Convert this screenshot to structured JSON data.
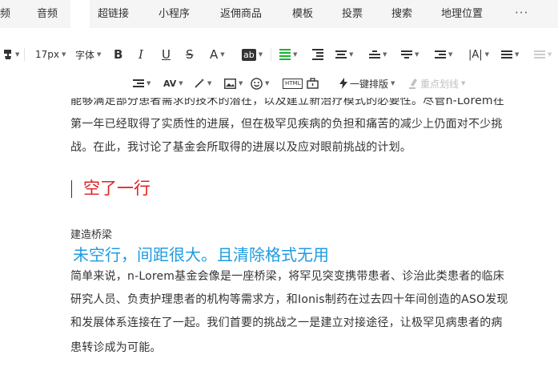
{
  "insert_bar": {
    "items": [
      {
        "label": "频"
      },
      {
        "label": "音频"
      },
      {
        "label": "超链接"
      },
      {
        "label": "小程序"
      },
      {
        "label": "返佣商品"
      },
      {
        "label": "模板"
      },
      {
        "label": "投票"
      },
      {
        "label": "搜索"
      },
      {
        "label": "地理位置"
      }
    ],
    "more": "···"
  },
  "toolbar": {
    "font_size": "17px",
    "font_family": "字体",
    "bold": "B",
    "italic": "I",
    "underline": "U",
    "strike": "S",
    "font_color": "A",
    "background_color": "ab",
    "one_click_layout": "一键排版",
    "highlight": "重点划线",
    "colors": {
      "align_active": "#17b530",
      "disabled": "#c0c0c0"
    }
  },
  "content": {
    "para1_line0": "能够满足部分患者需求的技术的潜在，以及建立新治疗模式的必要性。尽管n-Lorem在",
    "para1_line1": "第一年已经取得了实质性的进展，但在极罕见疾病的负担和痛苦的减少上仍面对不少挑",
    "para1_line2": "战。在此，我讨论了基金会所取得的进展以及应对眼前挑战的计划。",
    "red_heading": "空了一行",
    "small_title": "建造桥梁",
    "blue_heading": "未空行，间距很大。且清除格式无用",
    "para2_line0": "简单来说，n-Lorem基金会像是一座桥梁，将罕见突变携带患者、诊治此类患者的临床",
    "para2_line1": "研究人员、负责护理患者的机构等需求方，和Ionis制药在过去四十年间创造的ASO发现",
    "para2_line2": "和发展体系连接在了一起。我们首要的挑战之一是建立对接途径，让极罕见病患者的病",
    "para2_line3": "患转诊成为可能。",
    "colors": {
      "red_heading": "#e02020",
      "blue_heading": "#1e9be0"
    }
  }
}
